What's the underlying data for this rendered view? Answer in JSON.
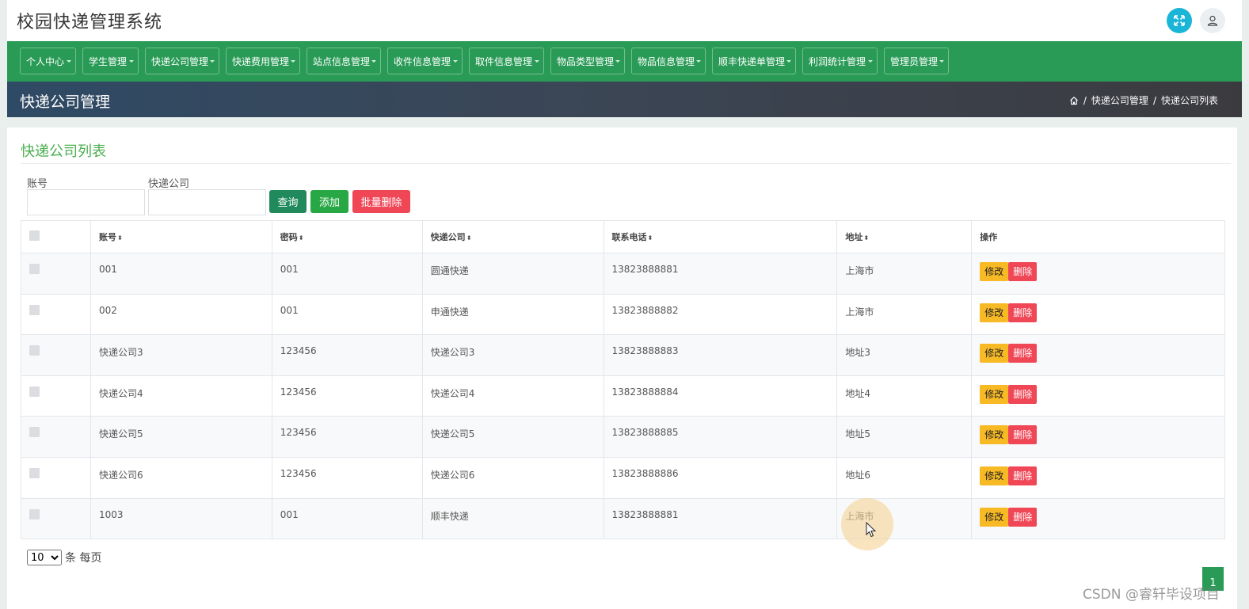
{
  "app": {
    "title": "校园快递管理系统"
  },
  "header_icons": {
    "fullscreen": "expand-icon",
    "user": "user-icon"
  },
  "nav": {
    "items": [
      {
        "label": "个人中心"
      },
      {
        "label": "学生管理"
      },
      {
        "label": "快递公司管理"
      },
      {
        "label": "快递费用管理"
      },
      {
        "label": "站点信息管理"
      },
      {
        "label": "收件信息管理"
      },
      {
        "label": "取件信息管理"
      },
      {
        "label": "物品类型管理"
      },
      {
        "label": "物品信息管理"
      },
      {
        "label": "顺丰快递单管理"
      },
      {
        "label": "利润统计管理"
      },
      {
        "label": "管理员管理"
      }
    ]
  },
  "pagehead": {
    "title": "快递公司管理",
    "breadcrumb": [
      "快递公司管理",
      "快递公司列表"
    ],
    "separator": "/"
  },
  "card": {
    "title": "快递公司列表"
  },
  "filters": {
    "account_label": "账号",
    "account_value": "",
    "company_label": "快递公司",
    "company_value": ""
  },
  "buttons": {
    "query": "查询",
    "add": "添加",
    "batch_delete": "批量删除"
  },
  "table": {
    "columns": [
      "账号",
      "密码",
      "快递公司",
      "联系电话",
      "地址",
      "操作"
    ],
    "sort_glyph": "⬍",
    "edit_label": "修改",
    "delete_label": "删除",
    "rows": [
      {
        "account": "001",
        "password": "001",
        "company": "圆通快递",
        "phone": "13823888881",
        "address": "上海市"
      },
      {
        "account": "002",
        "password": "001",
        "company": "申通快递",
        "phone": "13823888882",
        "address": "上海市"
      },
      {
        "account": "快递公司3",
        "password": "123456",
        "company": "快递公司3",
        "phone": "13823888883",
        "address": "地址3"
      },
      {
        "account": "快递公司4",
        "password": "123456",
        "company": "快递公司4",
        "phone": "13823888884",
        "address": "地址4"
      },
      {
        "account": "快递公司5",
        "password": "123456",
        "company": "快递公司5",
        "phone": "13823888885",
        "address": "地址5"
      },
      {
        "account": "快递公司6",
        "password": "123456",
        "company": "快递公司6",
        "phone": "13823888886",
        "address": "地址6"
      },
      {
        "account": "1003",
        "password": "001",
        "company": "顺丰快递",
        "phone": "13823888881",
        "address": "上海市"
      }
    ]
  },
  "pagination": {
    "page_size": "10",
    "page_size_suffix": "条 每页",
    "current_page": "1"
  },
  "watermark": "CSDN @睿轩毕设项目",
  "colors": {
    "nav_green": "#2a9b57",
    "title_green": "#4caf50",
    "edit": "#f7b924",
    "delete": "#f04757",
    "add": "#28a745"
  }
}
